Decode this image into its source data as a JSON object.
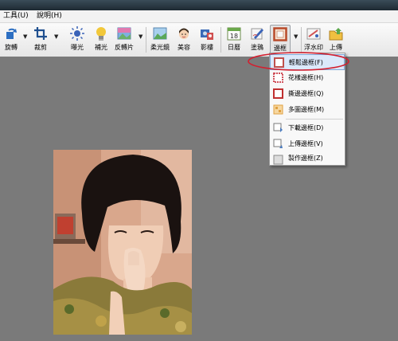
{
  "menu": [
    "工具(U)",
    "說明(H)"
  ],
  "toolbar": [
    {
      "label": "旋轉",
      "icon": "rotate-icon"
    },
    {
      "label": "裁剪",
      "icon": "crop-icon"
    },
    {
      "label": "曝光",
      "icon": "exposure-icon"
    },
    {
      "label": "補光",
      "icon": "fill-light-icon"
    },
    {
      "label": "反轉片",
      "icon": "reversal-film-icon"
    },
    {
      "label": "柔光鏡",
      "icon": "soft-light-icon"
    },
    {
      "label": "美容",
      "icon": "beauty-icon"
    },
    {
      "label": "影樓",
      "icon": "studio-icon"
    },
    {
      "label": "日曆",
      "icon": "calendar-icon",
      "number": "18"
    },
    {
      "label": "塗鴉",
      "icon": "doodle-icon"
    },
    {
      "label": "邊框",
      "icon": "frame-icon"
    },
    {
      "label": "浮水印",
      "icon": "watermark-icon"
    },
    {
      "label": "上傳",
      "icon": "upload-icon"
    }
  ],
  "frame_menu": [
    {
      "label": "輕鬆邊框(F)",
      "icon": "easy-frame-icon",
      "color": "#c0504d"
    },
    {
      "label": "花樣邊框(H)",
      "icon": "pattern-frame-icon",
      "color": "#d0505a"
    },
    {
      "label": "撕邊邊框(Q)",
      "icon": "torn-frame-icon",
      "color": "#c03030"
    },
    {
      "label": "多圖邊框(M)",
      "icon": "multi-frame-icon",
      "color": "#e0a040"
    },
    {
      "label": "下載邊框(D)",
      "icon": "download-frame-icon",
      "color": "#4a7cc0"
    },
    {
      "label": "上傳邊框(V)",
      "icon": "upload-frame-icon",
      "color": "#4a7cc0"
    },
    {
      "label": "製作邊框(Z)",
      "icon": "make-frame-icon",
      "color": "#8a8a8a"
    }
  ],
  "colors": {
    "canvas": "#7a7a7a",
    "highlight_ring": "#d22030",
    "menu_highlight": "#dbe9fb"
  }
}
